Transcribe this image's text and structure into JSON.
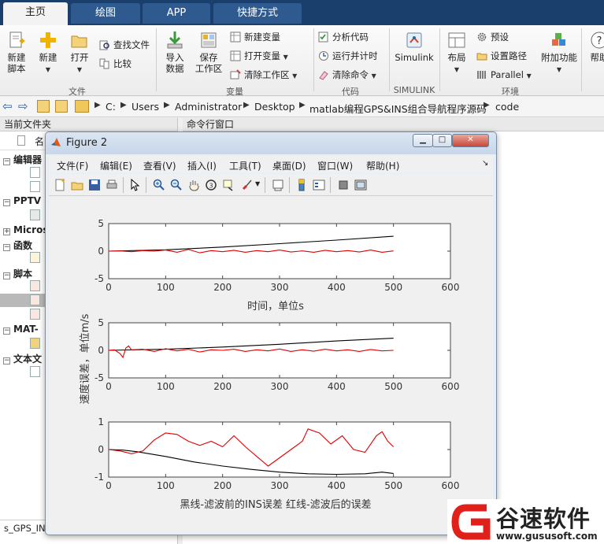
{
  "tabs": [
    {
      "label": "主页",
      "active": true
    },
    {
      "label": "绘图",
      "active": false
    },
    {
      "label": "APP",
      "active": false
    },
    {
      "label": "快捷方式",
      "active": false
    }
  ],
  "ribbon": {
    "file": {
      "new_script": "新建\n脚本",
      "new": "新建",
      "open": "打开",
      "find_files": "查找文件",
      "compare": "比较",
      "group": "文件"
    },
    "variable": {
      "import": "导入\n数据",
      "save_ws": "保存\n工作区",
      "new_var": "新建变量",
      "open_var": "打开变量",
      "clear_ws": "清除工作区",
      "group": "变量"
    },
    "code": {
      "analyze": "分析代码",
      "run_time": "运行并计时",
      "clear_cmd": "清除命令",
      "group": "代码"
    },
    "simulink": {
      "label": "Simulink",
      "group": "SIMULINK"
    },
    "env": {
      "layout": "布局",
      "prefs": "预设",
      "set_path": "设置路径",
      "parallel": "Parallel",
      "addons": "附加功能",
      "group": "环境"
    },
    "help": "帮助"
  },
  "address": {
    "crumbs": [
      "C:",
      "Users",
      "Administrator",
      "Desktop",
      "matlab编程GPS&INS组合导航程序源码",
      "code"
    ]
  },
  "left_panel": {
    "title": "当前文件夹",
    "name_col": "名",
    "items": [
      "编辑器",
      "PPTV",
      "Micros",
      "函数",
      "脚本",
      "MAT-",
      "文本文"
    ],
    "bottom_file": "s_GPS_IN"
  },
  "cmd_panel": {
    "title": "命令行窗口"
  },
  "figure": {
    "title": "Figure 2",
    "menus": [
      "文件(F)",
      "编辑(E)",
      "查看(V)",
      "插入(I)",
      "工具(T)",
      "桌面(D)",
      "窗口(W)",
      "帮助(H)"
    ],
    "ylabel": "速度误差，单位m/s",
    "xlabel_top": "时间，单位s",
    "xlabel_bottom": "黑线-滤波前的INS误差   红线-滤波后的误差"
  },
  "chart_data": [
    {
      "type": "line",
      "xlim": [
        0,
        600
      ],
      "ylim": [
        -5,
        5
      ],
      "xticks": [
        0,
        100,
        200,
        300,
        400,
        500,
        600
      ],
      "yticks": [
        -5,
        0,
        5
      ],
      "xlabel": "时间，单位s",
      "series": [
        {
          "color": "#000000",
          "x": [
            0,
            100,
            200,
            300,
            400,
            500
          ],
          "y": [
            0,
            0.25,
            0.75,
            1.35,
            2.0,
            2.7
          ]
        },
        {
          "color": "#e00000",
          "x": [
            0,
            20,
            40,
            60,
            80,
            100,
            120,
            140,
            160,
            180,
            200,
            220,
            240,
            260,
            280,
            300,
            320,
            340,
            360,
            380,
            400,
            420,
            440,
            460,
            480,
            500
          ],
          "y": [
            0,
            0.05,
            -0.1,
            0.1,
            0.0,
            0.2,
            -0.2,
            0.3,
            -0.3,
            0.1,
            -0.1,
            0.15,
            -0.2,
            0.1,
            -0.1,
            0.2,
            -0.15,
            0.05,
            -0.2,
            0.15,
            -0.1,
            0.1,
            -0.15,
            0.2,
            -0.2,
            0.05
          ]
        }
      ]
    },
    {
      "type": "line",
      "xlim": [
        0,
        600
      ],
      "ylim": [
        -5,
        5
      ],
      "xticks": [
        0,
        100,
        200,
        300,
        400,
        500,
        600
      ],
      "yticks": [
        -5,
        0,
        5
      ],
      "series": [
        {
          "color": "#000000",
          "x": [
            0,
            100,
            200,
            300,
            400,
            500
          ],
          "y": [
            0,
            0.2,
            0.6,
            1.1,
            1.7,
            2.2
          ]
        },
        {
          "color": "#e00000",
          "x": [
            0,
            10,
            20,
            25,
            30,
            35,
            40,
            60,
            80,
            100,
            120,
            140,
            160,
            180,
            200,
            220,
            240,
            260,
            280,
            300,
            320,
            340,
            360,
            380,
            400,
            420,
            440,
            460,
            480,
            500
          ],
          "y": [
            0,
            0.1,
            -0.6,
            -1.3,
            0.4,
            0.8,
            0.1,
            0.2,
            -0.2,
            0.3,
            -0.1,
            0.2,
            -0.3,
            0.1,
            0.0,
            0.2,
            -0.2,
            0.1,
            -0.1,
            0.25,
            -0.2,
            0.1,
            -0.15,
            0.2,
            -0.1,
            0.1,
            -0.2,
            0.15,
            -0.1,
            0.0
          ]
        }
      ]
    },
    {
      "type": "line",
      "xlim": [
        0,
        600
      ],
      "ylim": [
        -1,
        1
      ],
      "xticks": [
        0,
        100,
        200,
        300,
        400,
        500,
        600
      ],
      "yticks": [
        -1,
        0,
        1
      ],
      "xlabel": "黑线-滤波前的INS误差   红线-滤波后的误差",
      "series": [
        {
          "color": "#000000",
          "x": [
            0,
            25,
            50,
            100,
            150,
            200,
            250,
            300,
            350,
            400,
            450,
            480,
            500
          ],
          "y": [
            0,
            -0.02,
            -0.08,
            -0.25,
            -0.45,
            -0.6,
            -0.72,
            -0.82,
            -0.88,
            -0.9,
            -0.88,
            -0.82,
            -0.87
          ]
        },
        {
          "color": "#e00000",
          "x": [
            0,
            20,
            40,
            60,
            80,
            100,
            120,
            140,
            160,
            180,
            200,
            220,
            240,
            260,
            280,
            300,
            320,
            340,
            350,
            370,
            390,
            410,
            430,
            450,
            470,
            480,
            490,
            500
          ],
          "y": [
            0,
            -0.05,
            -0.15,
            -0.05,
            0.35,
            0.6,
            0.55,
            0.3,
            0.15,
            0.3,
            0.1,
            0.5,
            0.1,
            -0.25,
            -0.6,
            -0.3,
            0.0,
            0.3,
            0.75,
            0.6,
            0.2,
            0.5,
            0.0,
            -0.1,
            0.5,
            0.65,
            0.3,
            0.1
          ]
        }
      ]
    }
  ],
  "watermark": {
    "brand": "谷速软件",
    "url": "www.gususoft.com"
  },
  "colors": {
    "tabbar": "#1b3f6d",
    "accent_red": "#e00000",
    "watermark_red": "#e0201a"
  }
}
